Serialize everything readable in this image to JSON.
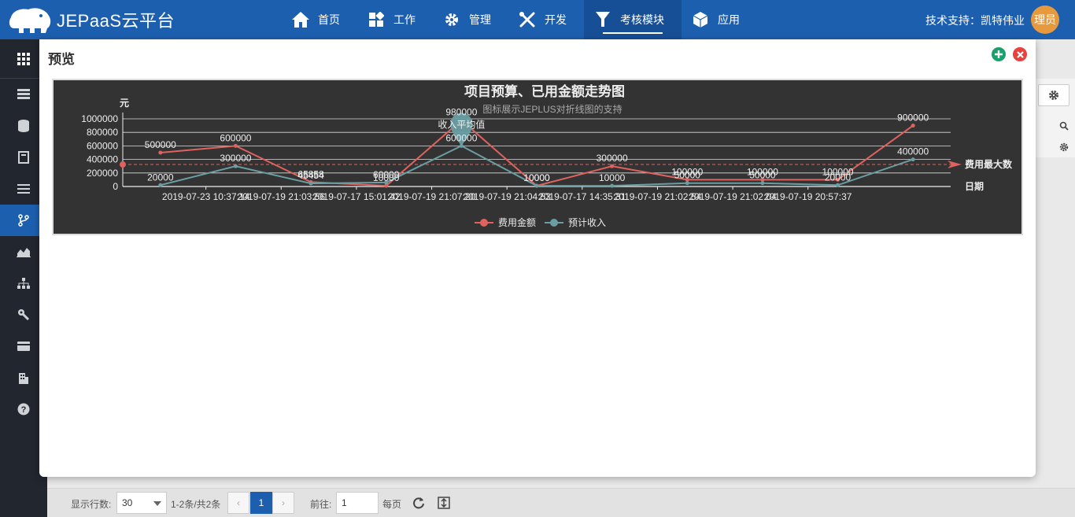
{
  "app": {
    "logo_text": "JEPaaS云平台",
    "support_text": "技术支持：凯特伟业",
    "avatar_text": "理员"
  },
  "nav": [
    {
      "label": "首页",
      "icon": "home-icon"
    },
    {
      "label": "工作",
      "icon": "grid-icon"
    },
    {
      "label": "管理",
      "icon": "gear-icon"
    },
    {
      "label": "开发",
      "icon": "tools-icon"
    },
    {
      "label": "考核模块",
      "icon": "filter-icon",
      "active": true
    },
    {
      "label": "应用",
      "icon": "cube-icon"
    }
  ],
  "sidebar": [
    "apps-grid-icon",
    "server-icon",
    "database-icon",
    "book-icon",
    "list-icon",
    "branch-icon",
    "area-chart-icon",
    "org-chart-icon",
    "wrench-icon",
    "card-icon",
    "building-icon",
    "help-icon"
  ],
  "modal": {
    "title": "预览"
  },
  "chart_data": {
    "type": "line",
    "title": "项目预算、已用金额走势图",
    "subtitle": "图标展示JEPLUS对折线图的支持",
    "ylabel": "元",
    "xlabel": "日期",
    "ylim": [
      0,
      1000000
    ],
    "yticks": [
      "0",
      "200000",
      "400000",
      "600000",
      "800000",
      "1000000"
    ],
    "categories": [
      "2019-07-23 10:37:14",
      "2019-07-19 21:03:56",
      "2019-07-17 15:01:42",
      "2019-07-19 21:07:20",
      "2019-07-19 21:04:53",
      "2019-07-17 14:35:31",
      "2019-07-19 21:02:54",
      "2019-07-19 21:02:04",
      "2019-07-19 20:57:37"
    ],
    "series": [
      {
        "name": "费用金额",
        "color": "#e0625f",
        "values": [
          500000,
          600000,
          65858,
          10000,
          980000,
          10000,
          300000,
          100000,
          100000,
          100000,
          900000
        ]
      },
      {
        "name": "预计收入",
        "color": "#6a9ea3",
        "values": [
          20000,
          300000,
          45454,
          60000,
          600000,
          10000,
          10000,
          50000,
          50000,
          20000,
          400000
        ]
      }
    ],
    "series_point_labels": [
      [
        "500000",
        "600000",
        "65858",
        "10000",
        "980000",
        "10000",
        "300000",
        "100000",
        "100000",
        "100000",
        "900000"
      ],
      [
        "20000",
        "300000",
        "45454",
        "60000",
        "600000",
        "10000",
        "10000",
        "50000",
        "50000",
        "20000",
        "400000"
      ]
    ],
    "markline": {
      "label": "费用最大数",
      "value": 325000
    },
    "markpoint": {
      "label": "收入平均值"
    },
    "legend_position": "bottom-center",
    "grid": true
  },
  "footer": {
    "rows_label": "显示行数:",
    "rows_value": "30",
    "range_text": "1-2条/共2条",
    "prev": "‹",
    "page": "1",
    "next": "›",
    "goto_label": "前往:",
    "goto_value": "1",
    "per_page": "每页"
  }
}
